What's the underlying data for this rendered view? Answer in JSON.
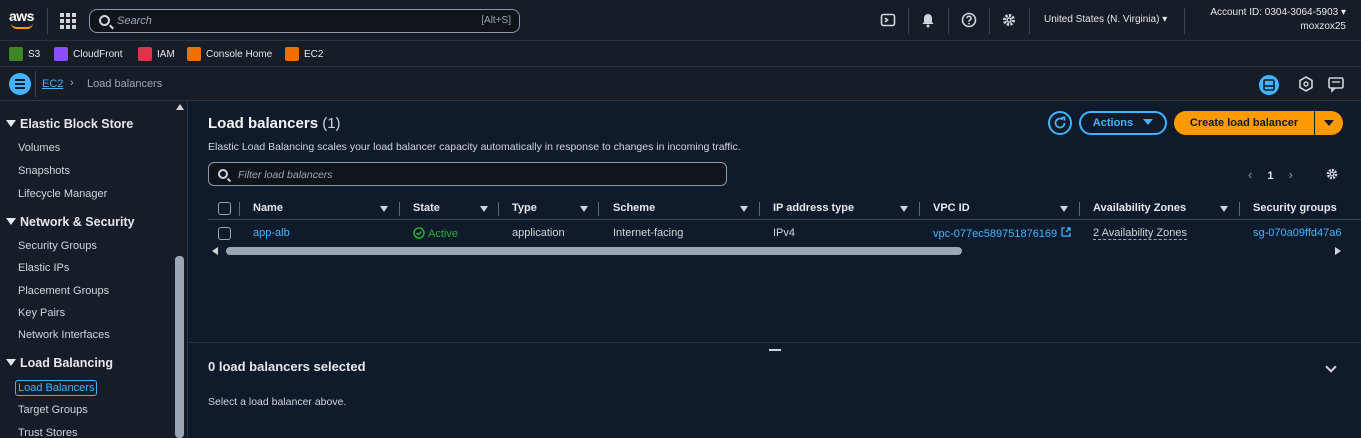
{
  "topbar": {
    "logo_text": "aws",
    "search_placeholder": "Search",
    "search_shortcut": "[Alt+S]",
    "region": "United States (N. Virginia) ▾",
    "account_id": "Account ID: 0304-3064-5903 ▾",
    "username": "moxzox25"
  },
  "favorites": [
    {
      "label": "S3",
      "color": "#3f8624"
    },
    {
      "label": "CloudFront",
      "color": "#8c4fff"
    },
    {
      "label": "IAM",
      "color": "#dd344c"
    },
    {
      "label": "Console Home",
      "color": "#ed7100"
    },
    {
      "label": "EC2",
      "color": "#ed7100"
    }
  ],
  "breadcrumb": {
    "root": "EC2",
    "separator": "›",
    "current": "Load balancers"
  },
  "sidebar": {
    "sections": [
      {
        "label": "Elastic Block Store",
        "items": [
          "Volumes",
          "Snapshots",
          "Lifecycle Manager"
        ]
      },
      {
        "label": "Network & Security",
        "items": [
          "Security Groups",
          "Elastic IPs",
          "Placement Groups",
          "Key Pairs",
          "Network Interfaces"
        ]
      },
      {
        "label": "Load Balancing",
        "items": [
          "Load Balancers",
          "Target Groups",
          "Trust Stores"
        ]
      }
    ]
  },
  "main": {
    "title": "Load balancers",
    "count": "(1)",
    "description": "Elastic Load Balancing scales your load balancer capacity automatically in response to changes in incoming traffic.",
    "actions_label": "Actions",
    "create_label": "Create load balancer",
    "filter_placeholder": "Filter load balancers",
    "page": "1"
  },
  "table": {
    "columns": [
      "Name",
      "State",
      "Type",
      "Scheme",
      "IP address type",
      "VPC ID",
      "Availability Zones",
      "Security groups"
    ],
    "rows": [
      {
        "name": "app-alb",
        "state": "Active",
        "type": "application",
        "scheme": "Internet-facing",
        "ip_type": "IPv4",
        "vpc_id": "vpc-077ec589751876169",
        "azs": "2 Availability Zones",
        "sgs": "sg-070a09ffd47a6"
      }
    ]
  },
  "split_panel": {
    "selected_text": "0 load balancers selected",
    "hint": "Select a load balancer above."
  },
  "colors": {
    "accent": "#42b4ff",
    "primary_button": "#ff9900",
    "active_status": "#29ad32"
  }
}
